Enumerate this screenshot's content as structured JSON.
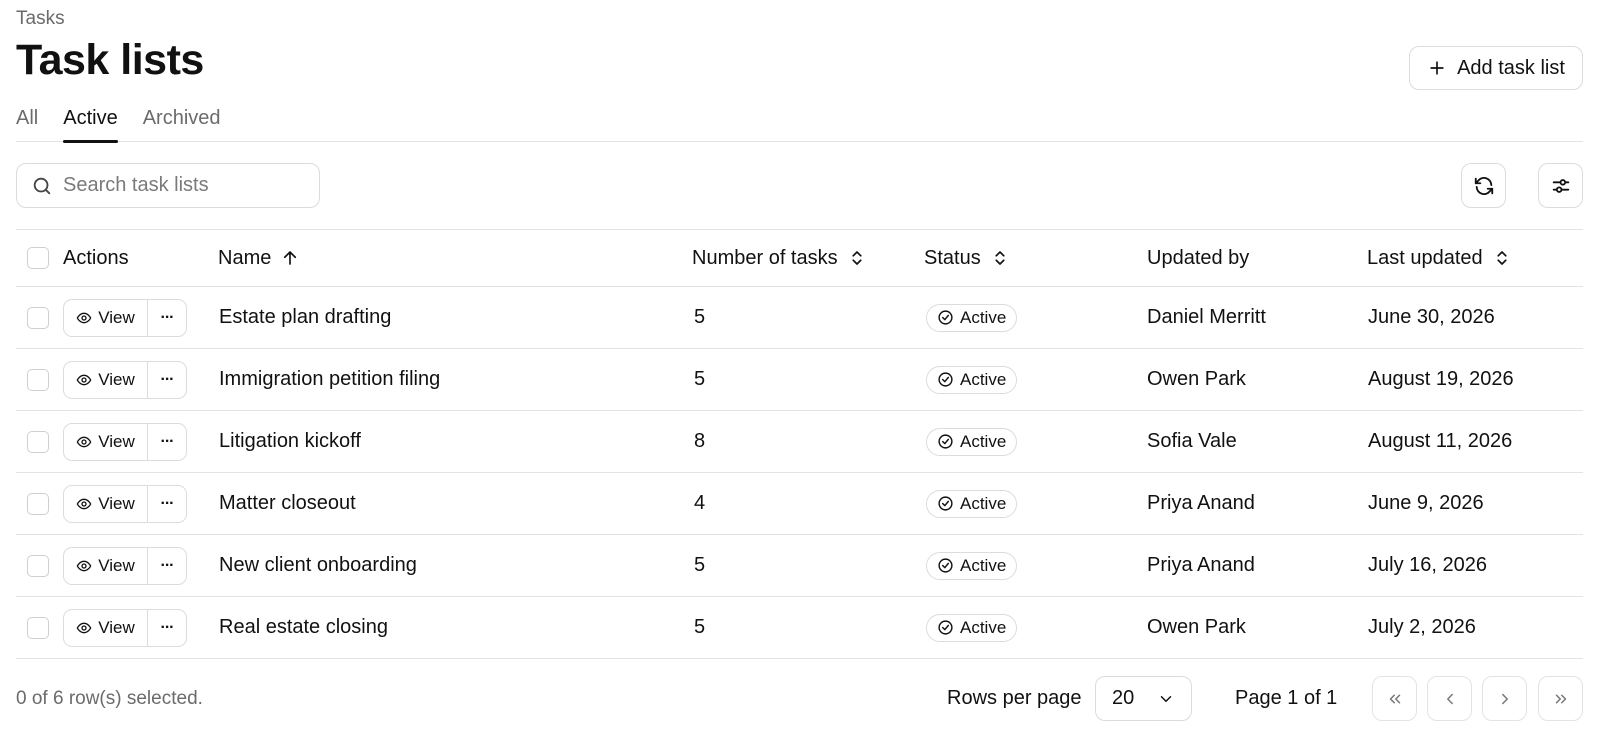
{
  "breadcrumb": "Tasks",
  "page_title": "Task lists",
  "add_button": {
    "label": "Add task list",
    "icon": "plus-icon"
  },
  "tabs": [
    {
      "label": "All",
      "active": false
    },
    {
      "label": "Active",
      "active": true
    },
    {
      "label": "Archived",
      "active": false
    }
  ],
  "search": {
    "placeholder": "Search task lists",
    "value": "",
    "icon": "search-icon"
  },
  "toolbar": {
    "refresh_icon": "refresh-icon",
    "settings_icon": "sliders-icon"
  },
  "table": {
    "columns": [
      {
        "label": "Actions"
      },
      {
        "label": "Name",
        "sort": "asc"
      },
      {
        "label": "Number of tasks",
        "sort": "none"
      },
      {
        "label": "Status",
        "sort": "none"
      },
      {
        "label": "Updated by"
      },
      {
        "label": "Last updated",
        "sort": "none"
      }
    ],
    "view_label": "View",
    "more_label": "···",
    "rows": [
      {
        "name": "Estate plan drafting",
        "tasks": "5",
        "status": "Active",
        "updated_by": "Daniel Merritt",
        "last_updated": "June 30, 2026"
      },
      {
        "name": "Immigration petition filing",
        "tasks": "5",
        "status": "Active",
        "updated_by": "Owen Park",
        "last_updated": "August 19, 2026"
      },
      {
        "name": "Litigation kickoff",
        "tasks": "8",
        "status": "Active",
        "updated_by": "Sofia Vale",
        "last_updated": "August 11, 2026"
      },
      {
        "name": "Matter closeout",
        "tasks": "4",
        "status": "Active",
        "updated_by": "Priya Anand",
        "last_updated": "June 9, 2026"
      },
      {
        "name": "New client onboarding",
        "tasks": "5",
        "status": "Active",
        "updated_by": "Priya Anand",
        "last_updated": "July 16, 2026"
      },
      {
        "name": "Real estate closing",
        "tasks": "5",
        "status": "Active",
        "updated_by": "Owen Park",
        "last_updated": "July 2, 2026"
      }
    ]
  },
  "footer": {
    "selection": "0 of 6 row(s) selected.",
    "rows_per_page_label": "Rows per page",
    "rows_per_page_value": "20",
    "page_info": "Page 1 of 1"
  }
}
